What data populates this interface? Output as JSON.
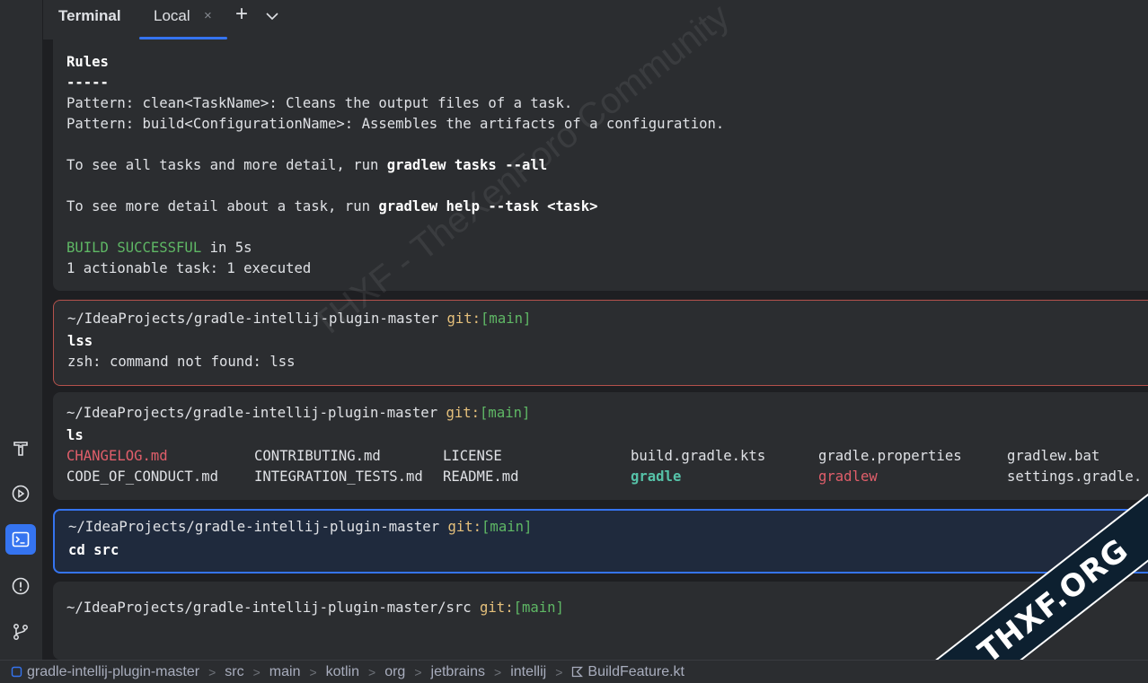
{
  "tabbar": {
    "title": "Terminal",
    "tab_label": "Local",
    "close_glyph": "×",
    "add_glyph": "+"
  },
  "left_strip": {
    "icons": [
      "build-hammer-icon",
      "run-icon",
      "terminal-icon",
      "problems-icon",
      "git-branch-icon"
    ],
    "accent": "#3574f0"
  },
  "output": {
    "rules_heading": "Rules",
    "rules_underline": "-----",
    "pattern_clean": "Pattern: clean<TaskName>: Cleans the output files of a task.",
    "pattern_build": "Pattern: build<ConfigurationName>: Assembles the artifacts of a configuration.",
    "see_all_prefix": "To see all tasks and more detail, run ",
    "see_all_cmd": "gradlew tasks --all",
    "see_more_prefix": "To see more detail about a task, run ",
    "see_more_cmd": "gradlew help --task <task>",
    "build_status": "BUILD SUCCESSFUL",
    "build_time": " in 5s",
    "actionable": "1 actionable task: 1 executed"
  },
  "blocks": {
    "prompt_path": "~/IdeaProjects/gradle-intellij-plugin-master",
    "git_label": "git:",
    "branch": "[main]",
    "error_cmd": "lss",
    "error_msg": "zsh: command not found: lss",
    "ls_cmd": "ls",
    "ls_row1": [
      "CHANGELOG.md",
      "CONTRIBUTING.md",
      "LICENSE",
      "build.gradle.kts",
      "gradle.properties",
      "gradlew.bat"
    ],
    "ls_row2": [
      "CODE_OF_CONDUCT.md",
      "INTEGRATION_TESTS.md",
      "README.md",
      "gradle",
      "gradlew",
      "settings.gradle."
    ],
    "active_cmd": "cd src",
    "current_path": "~/IdeaProjects/gradle-intellij-plugin-master/src"
  },
  "breadcrumb": {
    "items": [
      "gradle-intellij-plugin-master",
      "src",
      "main",
      "kotlin",
      "org",
      "jetbrains",
      "intellij",
      "BuildFeature.kt"
    ],
    "separator": ">"
  },
  "watermark": {
    "text": "THXF - TheXenForo Community",
    "badge": "THXF.ORG"
  }
}
